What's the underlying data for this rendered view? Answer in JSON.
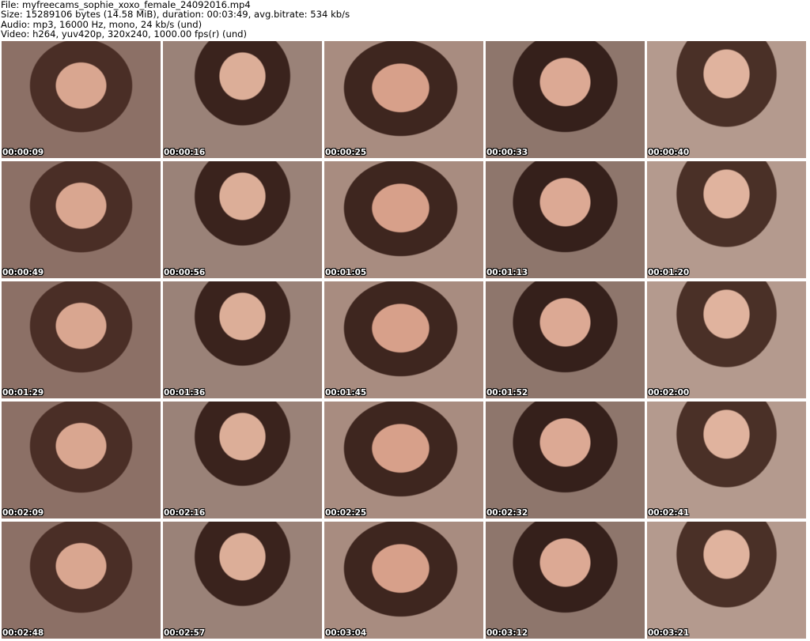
{
  "header": {
    "file_line": "File: myfreecams_sophie_xoxo_female_24092016.mp4",
    "size_line": "Size: 15289106 bytes (14.58 MiB), duration: 00:03:49, avg.bitrate: 534 kb/s",
    "audio_line": "Audio: mp3, 16000 Hz, mono, 24 kb/s (und)",
    "video_line": "Video: h264, yuv420p, 320x240, 1000.00 fps(r) (und)"
  },
  "thumbnails": [
    {
      "timestamp": "00:00:09"
    },
    {
      "timestamp": "00:00:16"
    },
    {
      "timestamp": "00:00:25"
    },
    {
      "timestamp": "00:00:33"
    },
    {
      "timestamp": "00:00:40"
    },
    {
      "timestamp": "00:00:49"
    },
    {
      "timestamp": "00:00:56"
    },
    {
      "timestamp": "00:01:05"
    },
    {
      "timestamp": "00:01:13"
    },
    {
      "timestamp": "00:01:20"
    },
    {
      "timestamp": "00:01:29"
    },
    {
      "timestamp": "00:01:36"
    },
    {
      "timestamp": "00:01:45"
    },
    {
      "timestamp": "00:01:52"
    },
    {
      "timestamp": "00:02:00"
    },
    {
      "timestamp": "00:02:09"
    },
    {
      "timestamp": "00:02:16"
    },
    {
      "timestamp": "00:02:25"
    },
    {
      "timestamp": "00:02:32"
    },
    {
      "timestamp": "00:02:41"
    },
    {
      "timestamp": "00:02:48"
    },
    {
      "timestamp": "00:02:57"
    },
    {
      "timestamp": "00:03:04"
    },
    {
      "timestamp": "00:03:12"
    },
    {
      "timestamp": "00:03:21"
    }
  ]
}
